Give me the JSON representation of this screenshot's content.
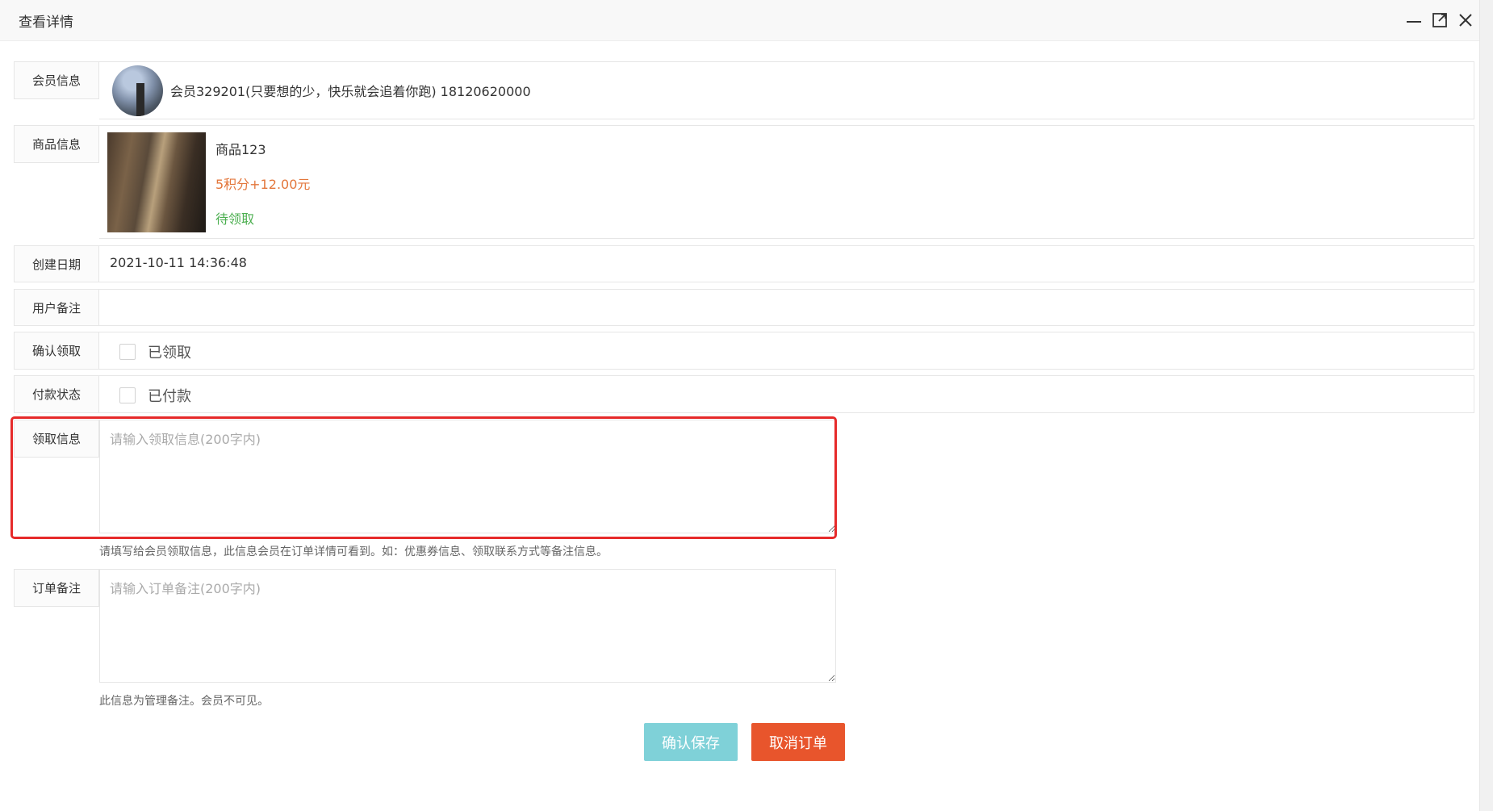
{
  "window": {
    "title": "查看详情",
    "minimize_icon": "minimize-icon",
    "maximize_icon": "maximize-icon",
    "close_icon": "close-icon"
  },
  "member": {
    "label": "会员信息",
    "text": "会员329201(只要想的少，快乐就会追着你跑) 18120620000"
  },
  "goods": {
    "label": "商品信息",
    "name": "商品123",
    "price": "5积分+12.00元",
    "status": "待领取",
    "price_color": "#e3773c",
    "status_color": "#4caf50"
  },
  "created": {
    "label": "创建日期",
    "value": "2021-10-11 14:36:48"
  },
  "user_note": {
    "label": "用户备注",
    "value": ""
  },
  "confirm_pickup": {
    "label": "确认领取",
    "option": "已领取",
    "checked": false
  },
  "payment_status": {
    "label": "付款状态",
    "option": "已付款",
    "checked": false
  },
  "pickup_info": {
    "label": "领取信息",
    "placeholder": "请输入领取信息(200字内)",
    "value": "",
    "hint": "请填写给会员领取信息，此信息会员在订单详情可看到。如：优惠券信息、领取联系方式等备注信息。"
  },
  "order_note": {
    "label": "订单备注",
    "placeholder": "请输入订单备注(200字内)",
    "value": "",
    "hint": "此信息为管理备注。会员不可见。"
  },
  "buttons": {
    "save": "确认保存",
    "cancel_order": "取消订单",
    "save_color": "#7fd1d8",
    "cancel_color": "#e8552c"
  },
  "highlight_color": "#e62a2a"
}
